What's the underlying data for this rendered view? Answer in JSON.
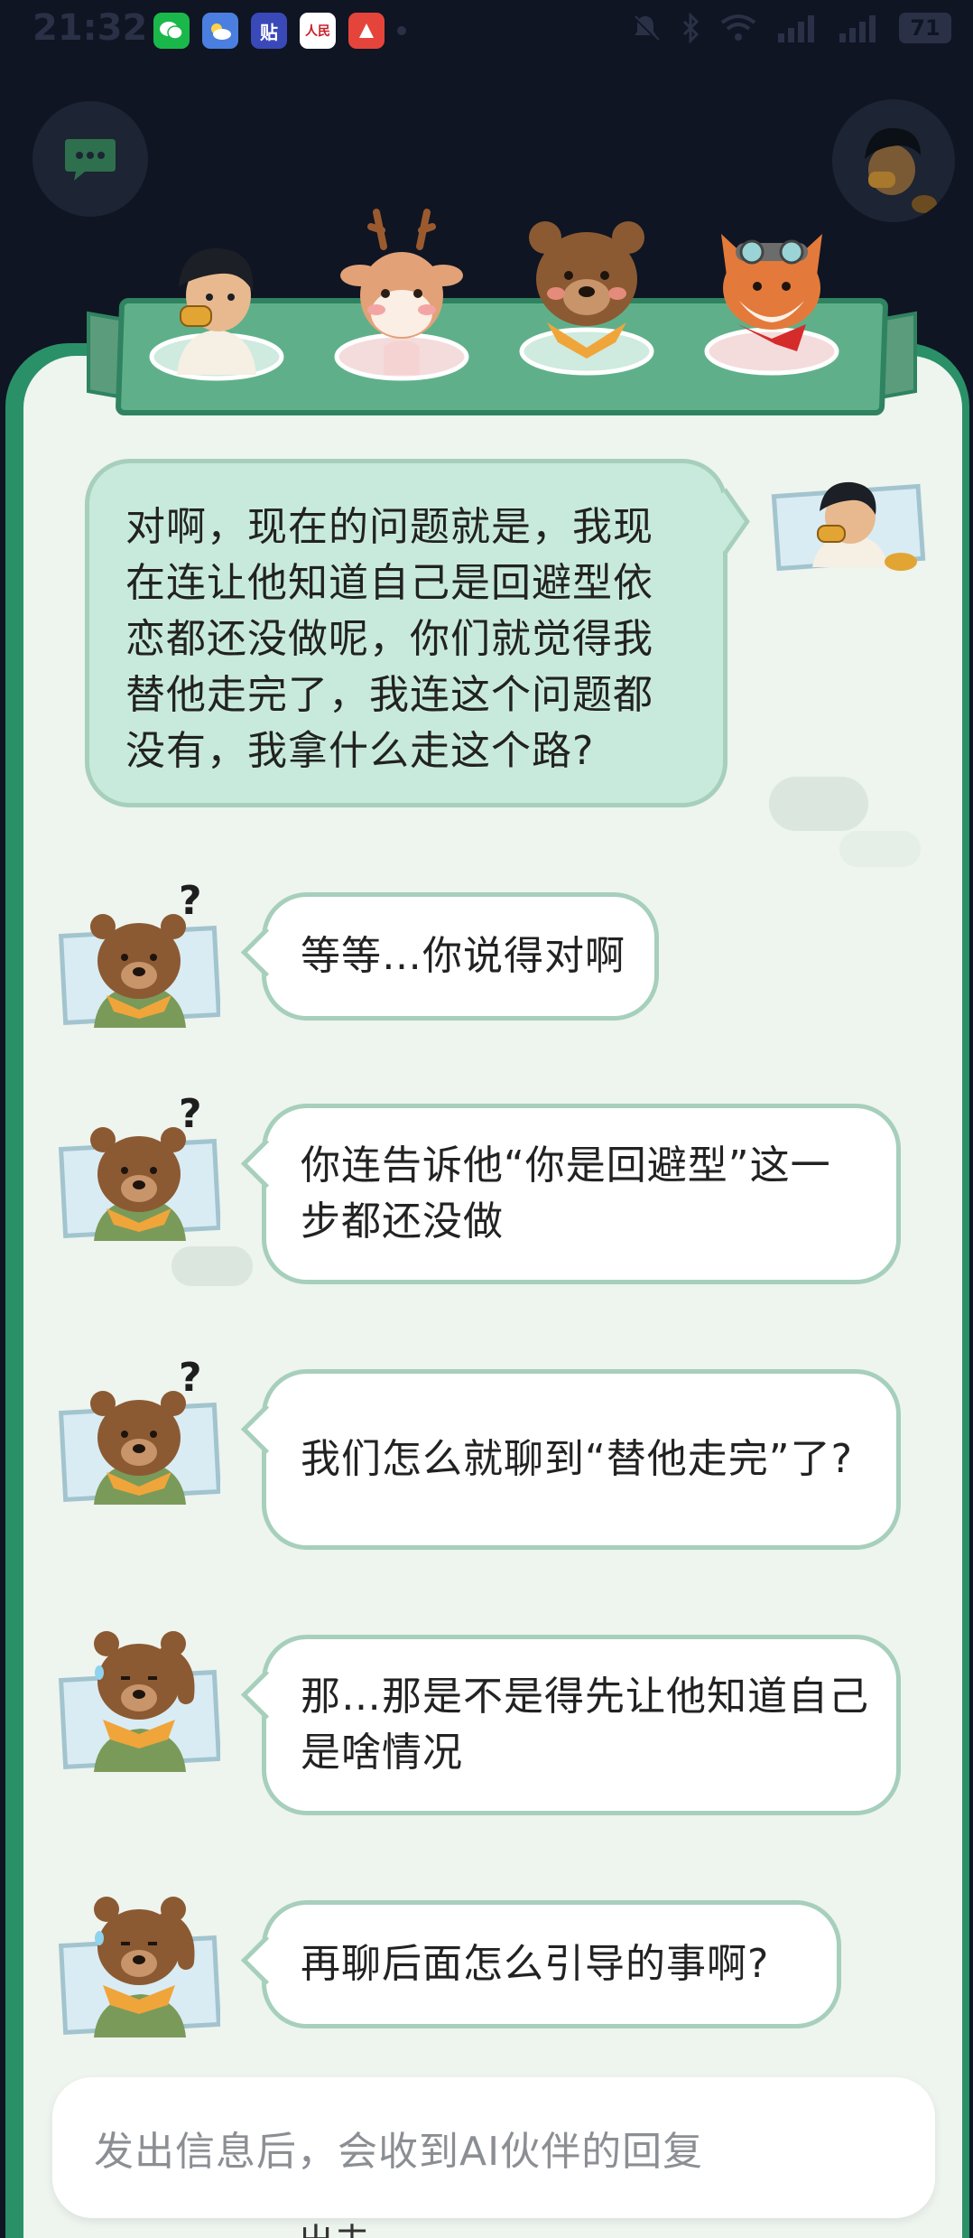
{
  "status_bar": {
    "time": "21:32",
    "notifications": [
      {
        "icon": "wechat-icon",
        "glyph": "✉"
      },
      {
        "icon": "weather-icon",
        "glyph": "☁"
      },
      {
        "icon": "tieba-icon",
        "glyph": "贴"
      },
      {
        "icon": "peoples-daily-icon",
        "glyph": "人民"
      },
      {
        "icon": "app-icon",
        "glyph": "●"
      }
    ],
    "battery": "71"
  },
  "characters": [
    {
      "name": "boy-character",
      "icon": "boy-avatar-icon"
    },
    {
      "name": "deer-character",
      "icon": "deer-avatar-icon"
    },
    {
      "name": "bear-character",
      "icon": "bear-avatar-icon"
    },
    {
      "name": "fox-character",
      "icon": "fox-avatar-icon"
    }
  ],
  "messages": {
    "user": "对啊，现在的问题就是，我现在连让他知道自己是回避型依恋都还没做呢，你们就觉得我替他走完了，我连这个问题都没有，我拿什么走这个路?",
    "bot": [
      "等等…你说得对啊",
      "你连告诉他“你是回避型”这一步都还没做",
      "我们怎么就聊到“替他走完”了?",
      "那…那是不是得先让他知道自己是啥情况",
      "再聊后面怎么引导的事啊?"
    ]
  },
  "input": {
    "placeholder": "发出信息后，会收到AI伙伴的回复"
  },
  "cut_off_text": "出去",
  "colors": {
    "board_green": "#2a9068",
    "board_bg": "#eef4ee",
    "user_bubble": "#c8eadc",
    "bubble_border": "#a6cfbc"
  }
}
